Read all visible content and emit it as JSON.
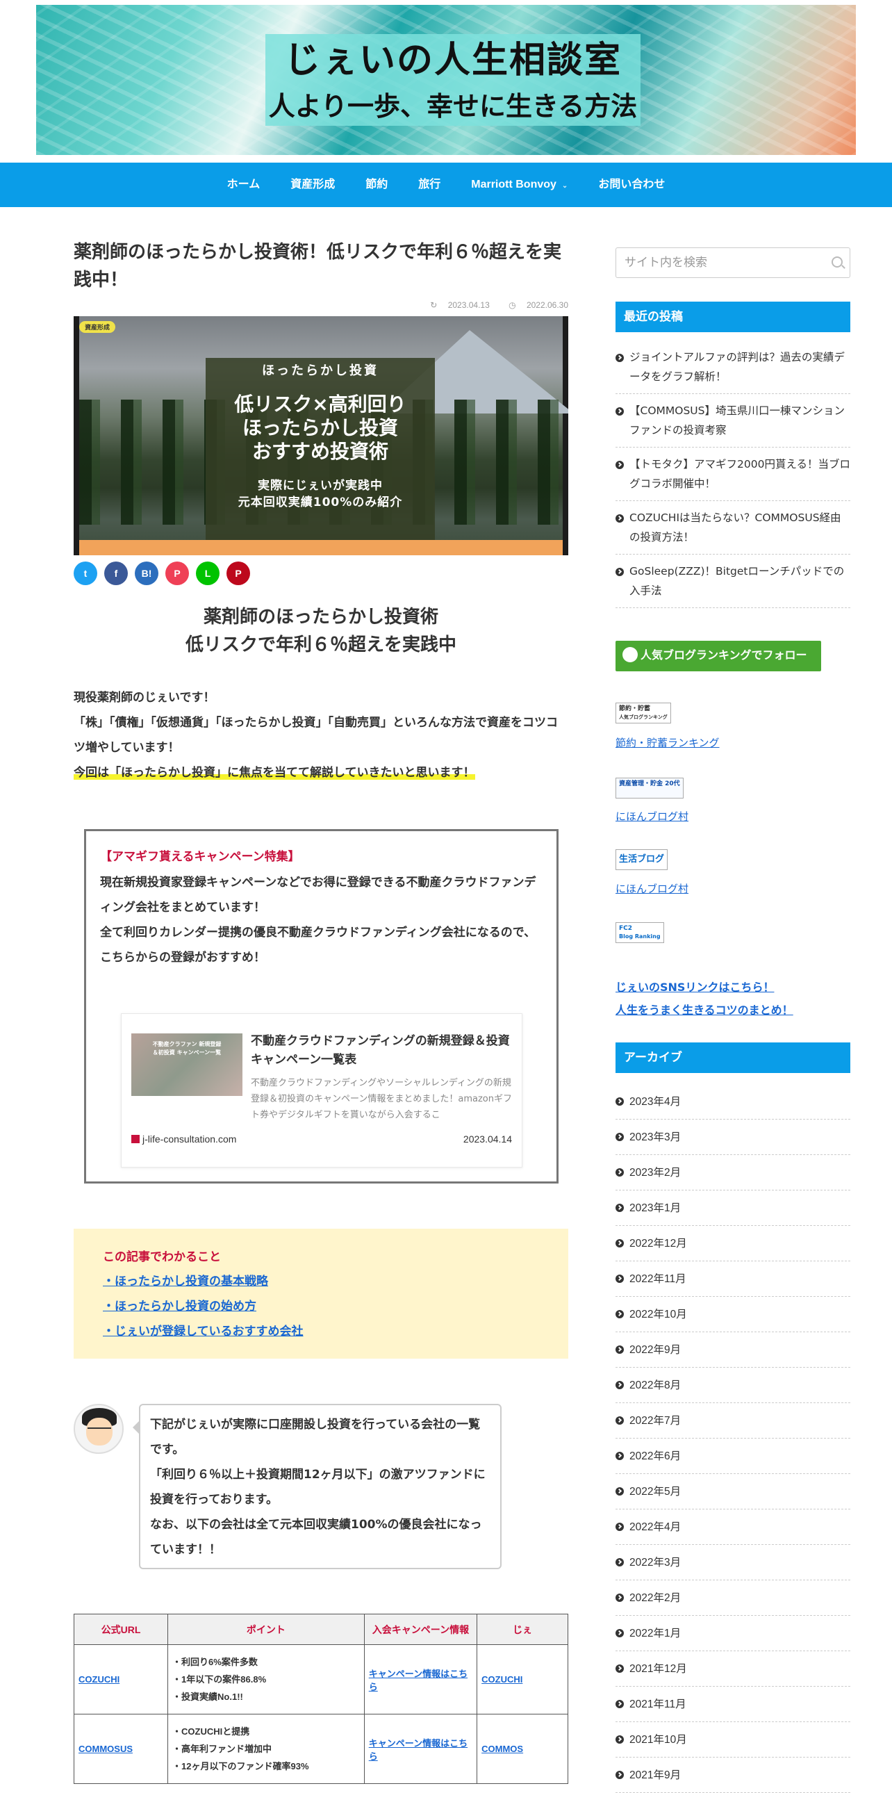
{
  "header": {
    "site_title": "じぇいの人生相談室",
    "site_subtitle": "人より一歩、幸せに生きる方法"
  },
  "nav": {
    "items": [
      "ホーム",
      "資産形成",
      "節約",
      "旅行",
      "Marriott Bonvoy",
      "お問い合わせ"
    ]
  },
  "post": {
    "title": "薬剤師のほったらかし投資術！低リスクで年利６％超えを実践中！",
    "updated": "2023.04.13",
    "published": "2022.06.30",
    "category": "資産形成",
    "eyecatch": {
      "line1": "ほったらかし投資",
      "line2": "低リスク×高利回り",
      "line3": "ほったらかし投資",
      "line4": "おすすめ投資術",
      "line5": "実際にじぇいが実践中",
      "line6": "元本回収実績100%のみ紹介"
    },
    "share": [
      "twitter-icon",
      "facebook-icon",
      "hatena-icon",
      "pocket-icon",
      "line-icon",
      "pinterest-icon"
    ],
    "share_labels": {
      "twitter": "t",
      "facebook": "f",
      "hatena": "B!",
      "pocket": "P",
      "line": "L",
      "pinterest": "P"
    },
    "heading_line1": "薬剤師のほったらかし投資術",
    "heading_line2": "低リスクで年利６％超えを実践中",
    "intro1": "現役薬剤師のじぇいです！",
    "intro2": "「株」「債権」「仮想通貨」「ほったらかし投資」「自動売買」といろんな方法で資産をコツコツ増やしています！",
    "intro3": "今回は「ほったらかし投資」に焦点を当てて解説していきたいと思います！",
    "campaign": {
      "title": "【アマギフ貰えるキャンペーン特集】",
      "body1": "現在新規投資家登録キャンペーンなどでお得に登録できる不動産クラウドファンディング会社をまとめています！",
      "body2": "全て利回りカレンダー提携の優良不動産クラウドファンディング会社になるので、こちらからの登録がおすすめ！",
      "card": {
        "thumb_text": "不動産クラファン 新規登録＆初投資 キャンペーン一覧",
        "title": "不動産クラウドファンディングの新規登録＆投資キャンペーン一覧表",
        "desc": "不動産クラウドファンディングやソーシャルレンディングの新規登録＆初投資のキャンペーン情報をまとめました！amazonギフト券やデジタルギフトを貰いながら入会するこ",
        "site": "j-life-consultation.com",
        "date": "2023.04.14"
      }
    },
    "summary": {
      "title": "この記事でわかること",
      "items": [
        "・ほったらかし投資の基本戦略",
        "・ほったらかし投資の始め方",
        "・じぇいが登録しているおすすめ会社"
      ]
    },
    "bubble": {
      "line1": "下記がじぇいが実際に口座開設し投資を行っている会社の一覧です。",
      "line2": "「利回り６％以上＋投資期間12ヶ月以下」の激アツファンドに投資を行っております。",
      "line3": "なお、以下の会社は全て元本回収実績100%の優良会社になっています！！"
    },
    "table": {
      "headers": [
        "公式URL",
        "ポイント",
        "入会キャンペーン情報",
        "じぇ"
      ],
      "rows": [
        {
          "name": "COZUCHI",
          "points": [
            "・利回り6%案件多数",
            "・1年以下の案件86.8%",
            "・投資実績No.1!!"
          ],
          "campaign": "キャンペーン情報はこちら",
          "extra": "COZUCHI"
        },
        {
          "name": "COMMOSUS",
          "points": [
            "・COZUCHIと提携",
            "・高年利ファンド増加中",
            "・12ヶ月以下のファンド確率93%"
          ],
          "campaign": "キャンペーン情報はこちら",
          "extra": "COMMOS"
        }
      ]
    }
  },
  "sidebar": {
    "search_placeholder": "サイト内を検索",
    "recent_title": "最近の投稿",
    "recent": [
      "ジョイントアルファの評判は？過去の実績データをグラフ解析！",
      "【COMMOSUS】埼玉県川口一棟マンションファンドの投資考察",
      "【トモタク】アマギフ2000円貰える！当ブログコラボ開催中！",
      "COZUCHIは当たらない？COMMOSUS経由の投資方法！",
      "GoSleep(ZZZ)！Bitgetローンチパッドでの入手法"
    ],
    "follow_label": "人気ブログランキングでフォロー",
    "rankings": [
      {
        "badge1": "節約・貯蓄",
        "badge2": "人気ブログランキング",
        "link": "節約・貯蓄ランキング"
      },
      {
        "badge1": "資産管理・貯金 20代",
        "badge2": "",
        "link": "にほんブログ村"
      },
      {
        "badge1": "生活ブログ",
        "badge2": "",
        "link": "にほんブログ村"
      },
      {
        "badge1": "FC2",
        "badge2": "Blog Ranking",
        "link": ""
      }
    ],
    "sns_link": "じぇいのSNSリンクはこちら！",
    "tips_link": "人生をうまく生きるコツのまとめ！",
    "archive_title": "アーカイブ",
    "archives": [
      "2023年4月",
      "2023年3月",
      "2023年2月",
      "2023年1月",
      "2022年12月",
      "2022年11月",
      "2022年10月",
      "2022年9月",
      "2022年8月",
      "2022年7月",
      "2022年6月",
      "2022年5月",
      "2022年4月",
      "2022年3月",
      "2022年2月",
      "2022年1月",
      "2021年12月",
      "2021年11月",
      "2021年10月",
      "2021年9月"
    ]
  },
  "colors": {
    "accent": "#0a9de8",
    "red": "#c8103c",
    "green": "#4aa832",
    "link": "#1967d2",
    "highlight": "#f6f32e"
  }
}
